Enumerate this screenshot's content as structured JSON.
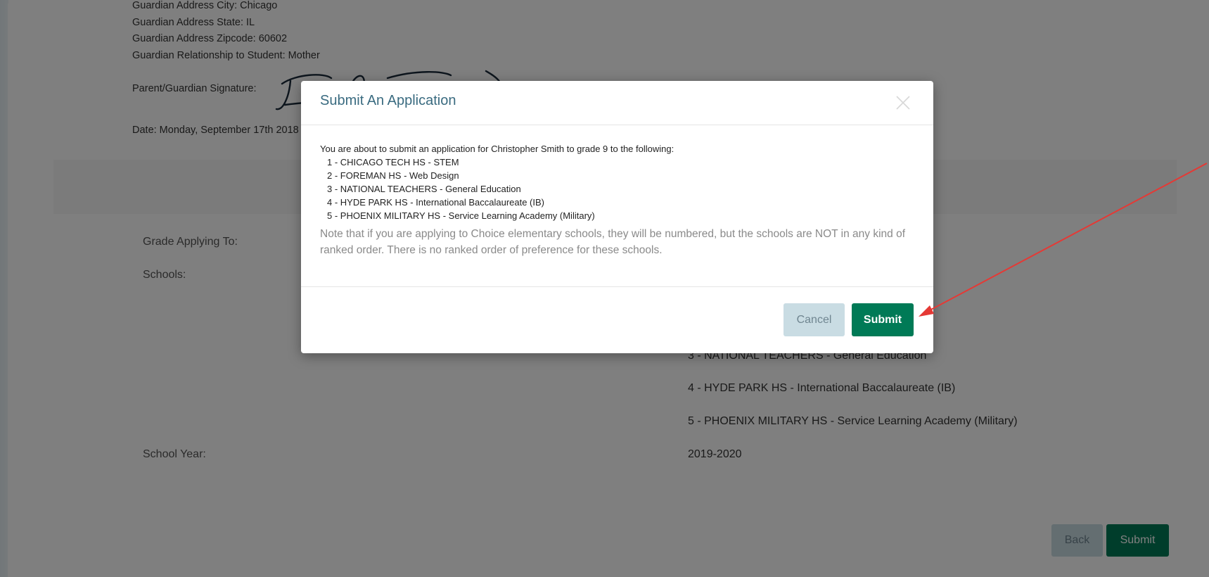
{
  "background_page": {
    "guardian_lines": [
      "Guardian Address City: Chicago",
      "Guardian Address State: IL",
      "Guardian Address Zipcode: 60602",
      "Guardian Relationship to Student: Mother"
    ],
    "signature_label": "Parent/Guardian Signature:",
    "date_line": "Date: Monday, September 17th 2018",
    "grade_label": "Grade Applying To:",
    "schools_label": "Schools:",
    "school_year_label": "School Year:",
    "school_year_value": "2019-2020",
    "visible_school_values": [
      "3 - NATIONAL TEACHERS - General Education",
      "4 - HYDE PARK HS - International Baccalaureate (IB)",
      "5 - PHOENIX MILITARY HS - Service Learning Academy (Military)"
    ],
    "back_label": "Back",
    "submit_label": "Submit"
  },
  "modal": {
    "title": "Submit An Application",
    "intro": "You are about to submit an application for Christopher Smith to grade 9 to the following:",
    "choices": [
      "1 - CHICAGO TECH HS - STEM",
      "2 - FOREMAN HS - Web Design",
      "3 - NATIONAL TEACHERS - General Education",
      "4 - HYDE PARK HS - International Baccalaureate (IB)",
      "5 - PHOENIX MILITARY HS - Service Learning Academy (Military)"
    ],
    "note": "Note that if you are applying to Choice elementary schools, they will be numbered, but the schools are NOT in any kind of ranked order. There is no ranked order of preference for these schools.",
    "cancel_label": "Cancel",
    "submit_label": "Submit"
  },
  "colors": {
    "accent_green": "#007a56",
    "muted_button": "#c9dce3",
    "title_blue": "#3a6b80",
    "annotation_arrow": "#e53935"
  },
  "icons": {
    "close": "close-icon",
    "annotation": "arrow-annotation"
  }
}
